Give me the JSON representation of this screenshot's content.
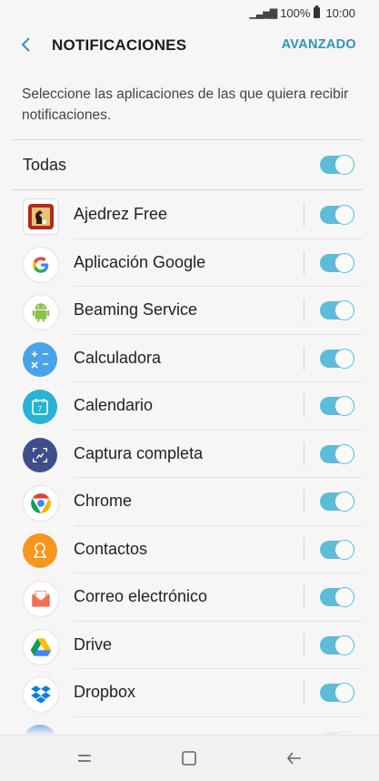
{
  "status_bar": {
    "battery": "100%",
    "time": "10:00"
  },
  "header": {
    "title": "NOTIFICACIONES",
    "advanced": "AVANZADO"
  },
  "description": "Seleccione las aplicaciones de las que quiera recibir notificaciones.",
  "all": {
    "label": "Todas",
    "enabled": true
  },
  "apps": [
    {
      "name": "Ajedrez Free",
      "icon": "chess-icon",
      "enabled": true
    },
    {
      "name": "Aplicación Google",
      "icon": "google-icon",
      "enabled": true
    },
    {
      "name": "Beaming Service",
      "icon": "android-icon",
      "enabled": true
    },
    {
      "name": "Calculadora",
      "icon": "calculator-icon",
      "enabled": true
    },
    {
      "name": "Calendario",
      "icon": "calendar-icon",
      "enabled": true
    },
    {
      "name": "Captura completa",
      "icon": "screenshot-icon",
      "enabled": true
    },
    {
      "name": "Chrome",
      "icon": "chrome-icon",
      "enabled": true
    },
    {
      "name": "Contactos",
      "icon": "contacts-icon",
      "enabled": true
    },
    {
      "name": "Correo electrónico",
      "icon": "email-icon",
      "enabled": true
    },
    {
      "name": "Drive",
      "icon": "drive-icon",
      "enabled": true
    },
    {
      "name": "Dropbox",
      "icon": "dropbox-icon",
      "enabled": true
    }
  ],
  "colors": {
    "accent": "#2f95b6",
    "toggle_on": "#5dbdd9"
  }
}
